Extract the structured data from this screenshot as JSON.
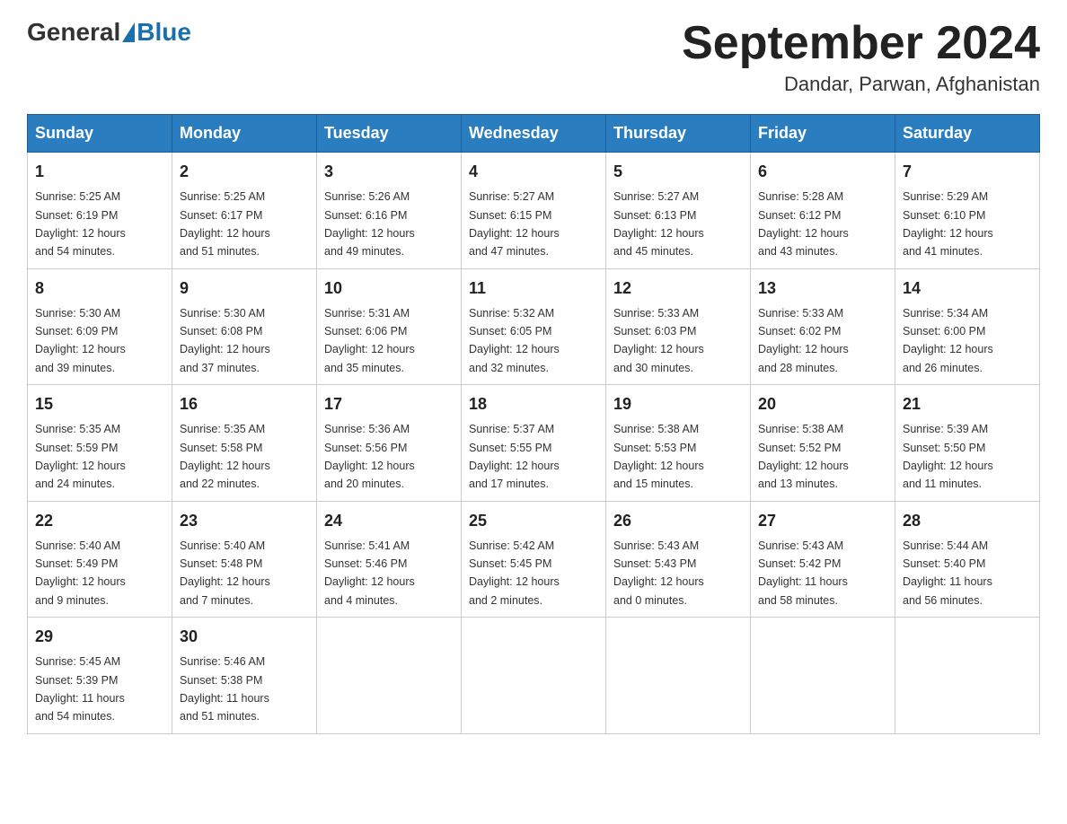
{
  "logo": {
    "general": "General",
    "blue": "Blue"
  },
  "title": "September 2024",
  "location": "Dandar, Parwan, Afghanistan",
  "headers": [
    "Sunday",
    "Monday",
    "Tuesday",
    "Wednesday",
    "Thursday",
    "Friday",
    "Saturday"
  ],
  "weeks": [
    [
      {
        "day": "1",
        "sunrise": "5:25 AM",
        "sunset": "6:19 PM",
        "daylight": "12 hours and 54 minutes."
      },
      {
        "day": "2",
        "sunrise": "5:25 AM",
        "sunset": "6:17 PM",
        "daylight": "12 hours and 51 minutes."
      },
      {
        "day": "3",
        "sunrise": "5:26 AM",
        "sunset": "6:16 PM",
        "daylight": "12 hours and 49 minutes."
      },
      {
        "day": "4",
        "sunrise": "5:27 AM",
        "sunset": "6:15 PM",
        "daylight": "12 hours and 47 minutes."
      },
      {
        "day": "5",
        "sunrise": "5:27 AM",
        "sunset": "6:13 PM",
        "daylight": "12 hours and 45 minutes."
      },
      {
        "day": "6",
        "sunrise": "5:28 AM",
        "sunset": "6:12 PM",
        "daylight": "12 hours and 43 minutes."
      },
      {
        "day": "7",
        "sunrise": "5:29 AM",
        "sunset": "6:10 PM",
        "daylight": "12 hours and 41 minutes."
      }
    ],
    [
      {
        "day": "8",
        "sunrise": "5:30 AM",
        "sunset": "6:09 PM",
        "daylight": "12 hours and 39 minutes."
      },
      {
        "day": "9",
        "sunrise": "5:30 AM",
        "sunset": "6:08 PM",
        "daylight": "12 hours and 37 minutes."
      },
      {
        "day": "10",
        "sunrise": "5:31 AM",
        "sunset": "6:06 PM",
        "daylight": "12 hours and 35 minutes."
      },
      {
        "day": "11",
        "sunrise": "5:32 AM",
        "sunset": "6:05 PM",
        "daylight": "12 hours and 32 minutes."
      },
      {
        "day": "12",
        "sunrise": "5:33 AM",
        "sunset": "6:03 PM",
        "daylight": "12 hours and 30 minutes."
      },
      {
        "day": "13",
        "sunrise": "5:33 AM",
        "sunset": "6:02 PM",
        "daylight": "12 hours and 28 minutes."
      },
      {
        "day": "14",
        "sunrise": "5:34 AM",
        "sunset": "6:00 PM",
        "daylight": "12 hours and 26 minutes."
      }
    ],
    [
      {
        "day": "15",
        "sunrise": "5:35 AM",
        "sunset": "5:59 PM",
        "daylight": "12 hours and 24 minutes."
      },
      {
        "day": "16",
        "sunrise": "5:35 AM",
        "sunset": "5:58 PM",
        "daylight": "12 hours and 22 minutes."
      },
      {
        "day": "17",
        "sunrise": "5:36 AM",
        "sunset": "5:56 PM",
        "daylight": "12 hours and 20 minutes."
      },
      {
        "day": "18",
        "sunrise": "5:37 AM",
        "sunset": "5:55 PM",
        "daylight": "12 hours and 17 minutes."
      },
      {
        "day": "19",
        "sunrise": "5:38 AM",
        "sunset": "5:53 PM",
        "daylight": "12 hours and 15 minutes."
      },
      {
        "day": "20",
        "sunrise": "5:38 AM",
        "sunset": "5:52 PM",
        "daylight": "12 hours and 13 minutes."
      },
      {
        "day": "21",
        "sunrise": "5:39 AM",
        "sunset": "5:50 PM",
        "daylight": "12 hours and 11 minutes."
      }
    ],
    [
      {
        "day": "22",
        "sunrise": "5:40 AM",
        "sunset": "5:49 PM",
        "daylight": "12 hours and 9 minutes."
      },
      {
        "day": "23",
        "sunrise": "5:40 AM",
        "sunset": "5:48 PM",
        "daylight": "12 hours and 7 minutes."
      },
      {
        "day": "24",
        "sunrise": "5:41 AM",
        "sunset": "5:46 PM",
        "daylight": "12 hours and 4 minutes."
      },
      {
        "day": "25",
        "sunrise": "5:42 AM",
        "sunset": "5:45 PM",
        "daylight": "12 hours and 2 minutes."
      },
      {
        "day": "26",
        "sunrise": "5:43 AM",
        "sunset": "5:43 PM",
        "daylight": "12 hours and 0 minutes."
      },
      {
        "day": "27",
        "sunrise": "5:43 AM",
        "sunset": "5:42 PM",
        "daylight": "11 hours and 58 minutes."
      },
      {
        "day": "28",
        "sunrise": "5:44 AM",
        "sunset": "5:40 PM",
        "daylight": "11 hours and 56 minutes."
      }
    ],
    [
      {
        "day": "29",
        "sunrise": "5:45 AM",
        "sunset": "5:39 PM",
        "daylight": "11 hours and 54 minutes."
      },
      {
        "day": "30",
        "sunrise": "5:46 AM",
        "sunset": "5:38 PM",
        "daylight": "11 hours and 51 minutes."
      },
      null,
      null,
      null,
      null,
      null
    ]
  ],
  "labels": {
    "sunrise": "Sunrise:",
    "sunset": "Sunset:",
    "daylight": "Daylight:"
  }
}
